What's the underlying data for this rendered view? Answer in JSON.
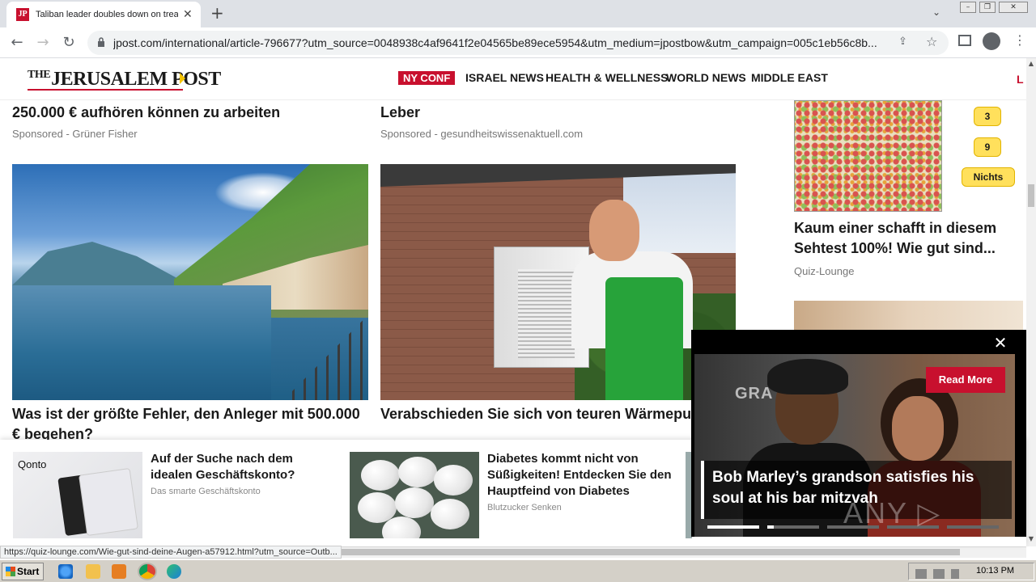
{
  "browser": {
    "tab": {
      "title": "Taliban leader doubles down on treat",
      "favicon_text": "JP"
    },
    "url": "jpost.com/international/article-796677?utm_source=0048938c4af9641f2e04565be89ece5954&utm_medium=jpostbow&utm_campaign=005c1eb56c8b..."
  },
  "site": {
    "logo_small": "THE",
    "logo_main": "JERUSALEM POST",
    "nav": {
      "ny_conf": "NY CONF",
      "israel_news": "ISRAEL NEWS",
      "health": "HEALTH & WELLNESS",
      "world_news": "WORLD NEWS",
      "middle_east": "MIDDLE EAST",
      "cut": "L"
    }
  },
  "articles": {
    "top_left_headline": "250.000 € aufhören können zu arbeiten",
    "top_left_sponsor": "Sponsored - Grüner Fisher",
    "top_right_headline": "Leber",
    "top_right_sponsor": "Sponsored - gesundheitswissenaktuell.com",
    "mid_left_headline": "Was ist der größte Fehler, den Anleger mit 500.000 € begehen?",
    "mid_right_headline": "Verabschieden Sie sich von teuren Wärmepumpen (wenn Sie ein Haus besitz"
  },
  "right_column": {
    "quiz_options": [
      "3",
      "9",
      "Nichts"
    ],
    "headline": "Kaum einer schafft in diesem Sehtest 100%! Wie gut sind...",
    "sponsor": "Quiz-Lounge"
  },
  "ad_bar": {
    "ad1": {
      "logo": "Qonto",
      "title": "Auf der Suche nach dem idealen Geschäftskonto?",
      "sponsor": "Das smarte Geschäftskonto"
    },
    "ad2": {
      "title": "Diabetes kommt nicht von Süßigkeiten! Entdecken Sie den Hauptfeind von Diabetes",
      "sponsor": "Blutzucker Senken"
    }
  },
  "video": {
    "read_more": "Read More",
    "caption": "Bob Marley’s grandson satisfies his soul at his bar mitzvah",
    "backdrop_text": "GRA",
    "watermark": "ANY ▷ RUN",
    "progress": 1.0
  },
  "status_url": "https://quiz-lounge.com/Wie-gut-sind-deine-Augen-a57912.html?utm_source=Outb...",
  "taskbar": {
    "start": "Start",
    "clock": "10:13 PM"
  },
  "colors": {
    "brand_red": "#c8102e",
    "quiz_yellow": "#ffe05c"
  }
}
